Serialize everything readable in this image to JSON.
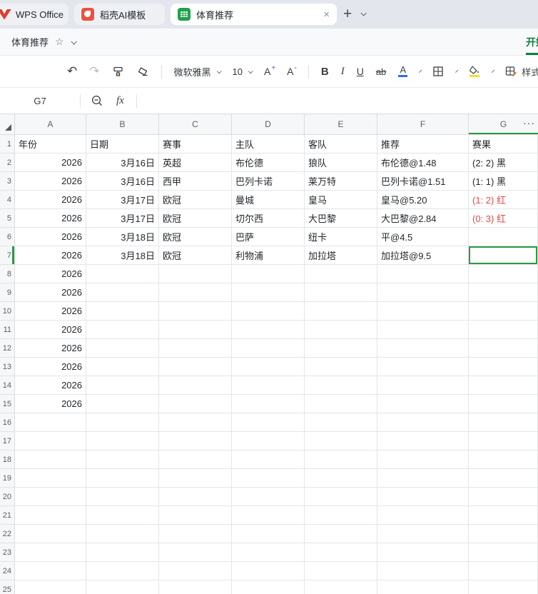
{
  "tabbar": {
    "tabs": [
      {
        "label": "WPS Office",
        "icon": "wps-logo",
        "active": false
      },
      {
        "label": "稻壳AI模板",
        "icon": "docer-ai",
        "active": false
      },
      {
        "label": "体育推荐",
        "icon": "spreadsheet",
        "active": true,
        "close_label": "×"
      }
    ],
    "new_tab_label": "+"
  },
  "titlebar": {
    "title": "体育推荐",
    "ribbon_tab": "开始"
  },
  "toolbar": {
    "font_name": "微软雅黑",
    "font_size": "10",
    "increase_font": "A",
    "increase_font_sign": "+",
    "decrease_font": "A",
    "decrease_font_sign": "-",
    "bold": "B",
    "italic": "I",
    "underline": "U",
    "strikethrough": "ab",
    "font_color_letter": "A",
    "style_label": "样式"
  },
  "formula_bar": {
    "cell_ref": "G7",
    "fx_label": "fx"
  },
  "grid": {
    "columns": [
      "A",
      "B",
      "C",
      "D",
      "E",
      "F",
      "G"
    ],
    "more_columns": "···",
    "row_count": 25,
    "selected_cell": "G7",
    "selected_row": 7,
    "selected_col": "G",
    "header_cells": [
      "年份",
      "日期",
      "赛事",
      "主队",
      "客队",
      "推荐",
      "赛果"
    ],
    "rows": [
      {
        "n": 2,
        "cells": [
          "2026",
          "3月16日",
          "英超",
          "布伦德",
          "狼队",
          "布伦德@1.48",
          "(2: 2) 黑"
        ],
        "result_red": false
      },
      {
        "n": 3,
        "cells": [
          "2026",
          "3月16日",
          "西甲",
          "巴列卡诺",
          "莱万特",
          "巴列卡诺@1.51",
          "(1: 1) 黑"
        ],
        "result_red": false
      },
      {
        "n": 4,
        "cells": [
          "2026",
          "3月17日",
          "欧冠",
          "曼城",
          "皇马",
          "皇马@5.20",
          "(1: 2) 红"
        ],
        "result_red": true
      },
      {
        "n": 5,
        "cells": [
          "2026",
          "3月17日",
          "欧冠",
          "切尔西",
          "大巴黎",
          "大巴黎@2.84",
          "(0: 3) 红"
        ],
        "result_red": true
      },
      {
        "n": 6,
        "cells": [
          "2026",
          "3月18日",
          "欧冠",
          "巴萨",
          "纽卡",
          "平@4.5",
          ""
        ],
        "result_red": false
      },
      {
        "n": 7,
        "cells": [
          "2026",
          "3月18日",
          "欧冠",
          "利物浦",
          "加拉塔",
          "加拉塔@9.5",
          ""
        ],
        "result_red": false
      },
      {
        "n": 8,
        "cells": [
          "2026",
          "",
          "",
          "",
          "",
          "",
          ""
        ],
        "result_red": false
      },
      {
        "n": 9,
        "cells": [
          "2026",
          "",
          "",
          "",
          "",
          "",
          ""
        ],
        "result_red": false
      },
      {
        "n": 10,
        "cells": [
          "2026",
          "",
          "",
          "",
          "",
          "",
          ""
        ],
        "result_red": false
      },
      {
        "n": 11,
        "cells": [
          "2026",
          "",
          "",
          "",
          "",
          "",
          ""
        ],
        "result_red": false
      },
      {
        "n": 12,
        "cells": [
          "2026",
          "",
          "",
          "",
          "",
          "",
          ""
        ],
        "result_red": false
      },
      {
        "n": 13,
        "cells": [
          "2026",
          "",
          "",
          "",
          "",
          "",
          ""
        ],
        "result_red": false
      },
      {
        "n": 14,
        "cells": [
          "2026",
          "",
          "",
          "",
          "",
          "",
          ""
        ],
        "result_red": false
      },
      {
        "n": 15,
        "cells": [
          "2026",
          "",
          "",
          "",
          "",
          "",
          ""
        ],
        "result_red": false
      }
    ]
  },
  "colors": {
    "accent_green": "#107c41",
    "selection_green": "#2a9b3f",
    "result_red": "#e64747",
    "font_color_blue": "#2f6fd6",
    "fill_yellow": "#f2df2e"
  }
}
